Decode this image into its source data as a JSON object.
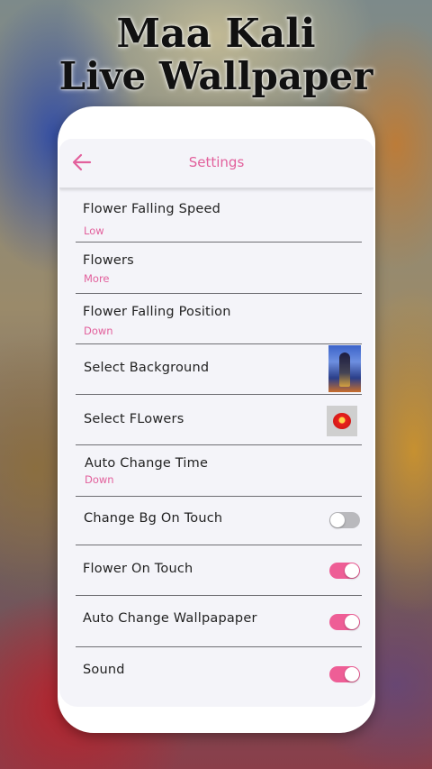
{
  "promo": {
    "line1": "Maa Kali",
    "line2": "Live Wallpaper"
  },
  "appbar": {
    "title": "Settings",
    "back_icon": "arrow-left-icon"
  },
  "settings": {
    "flower_speed": {
      "label": "Flower Falling Speed",
      "value": "Low"
    },
    "flowers": {
      "label": "Flowers",
      "value": "More"
    },
    "flower_position": {
      "label": "Flower Falling Position",
      "value": "Down"
    },
    "select_background": {
      "label": "Select Background",
      "thumbnail": "goddess-image-thumbnail"
    },
    "select_flowers": {
      "label": "Select FLowers",
      "thumbnail": "hibiscus-flower-thumbnail"
    },
    "auto_change_time": {
      "label": "Auto Change Time",
      "value": "Down"
    },
    "change_bg_on_touch": {
      "label": "Change Bg On Touch",
      "enabled": false
    },
    "flower_on_touch": {
      "label": "Flower On Touch",
      "enabled": true
    },
    "auto_change_wallpaper": {
      "label": "Auto Change Wallpapaper",
      "enabled": true
    },
    "sound": {
      "label": "Sound",
      "enabled": true
    }
  },
  "colors": {
    "accent": "#e2609c",
    "toggle_on": "#ee5e96",
    "toggle_off": "#b9b9bd",
    "screen_bg": "#f4f4f9"
  }
}
